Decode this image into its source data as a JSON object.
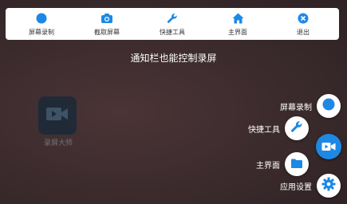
{
  "colors": {
    "accent": "#1e88e5",
    "bar_bg": "#ffffff",
    "background": "#3a2a2c"
  },
  "topbar": {
    "items": [
      {
        "label": "屏幕录制",
        "icon": "record-dot-icon"
      },
      {
        "label": "截取屏幕",
        "icon": "camera-icon"
      },
      {
        "label": "快捷工具",
        "icon": "wrench-icon"
      },
      {
        "label": "主界面",
        "icon": "home-icon"
      },
      {
        "label": "退出",
        "icon": "close-circle-icon"
      }
    ]
  },
  "notice": "通知栏也能控制录屏",
  "desktop_app": {
    "label": "录屏大师",
    "icon": "video-camera-icon"
  },
  "fab_menu": {
    "items": [
      {
        "label": "屏幕录制",
        "icon": "record-dot-icon"
      },
      {
        "label": "快捷工具",
        "icon": "wrench-icon"
      },
      {
        "label": "主界面",
        "icon": "folder-icon"
      },
      {
        "label": "应用设置",
        "icon": "gear-icon"
      }
    ],
    "main_icon": "video-camera-icon"
  }
}
